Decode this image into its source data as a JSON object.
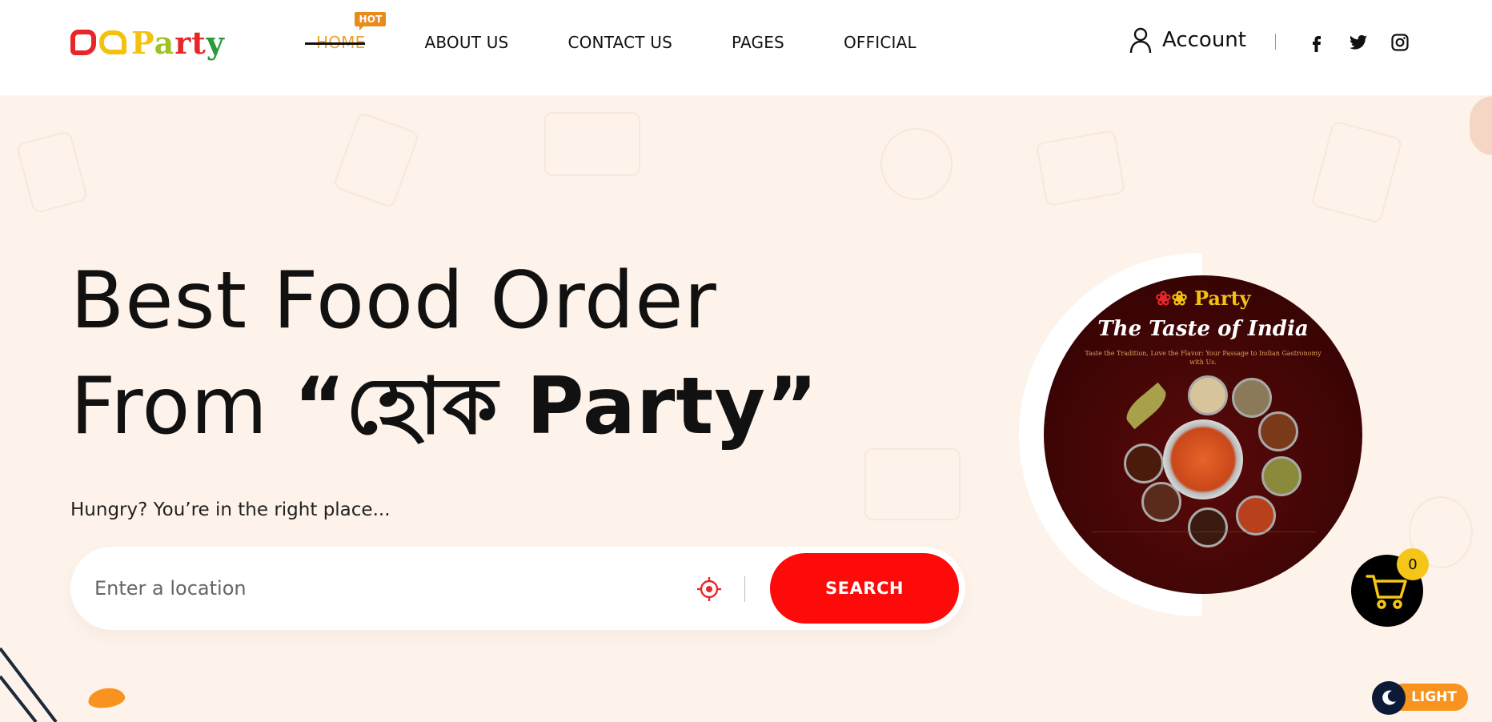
{
  "header": {
    "logo": {
      "alt": "হোক Party",
      "text_parts": [
        "P",
        "a",
        "r",
        "t",
        "y"
      ]
    },
    "nav": [
      {
        "label": "HOME",
        "active": true,
        "badge": "HOT"
      },
      {
        "label": "ABOUT US",
        "active": false
      },
      {
        "label": "CONTACT US",
        "active": false
      },
      {
        "label": "PAGES",
        "active": false
      },
      {
        "label": "OFFICIAL",
        "active": false
      }
    ],
    "account_label": "Account",
    "socials": [
      "facebook-icon",
      "twitter-icon",
      "instagram-icon"
    ]
  },
  "hero": {
    "title_line1": "Best Food Order",
    "title_line2_prefix": "From ",
    "title_line2_brand": "“হোক Party”",
    "subtitle": "Hungry? You’re in the right place..."
  },
  "search": {
    "placeholder": "Enter a location",
    "button_label": "SEARCH"
  },
  "promo": {
    "logo_text": "Party",
    "title": "The Taste of India",
    "tagline": "Taste the Tradition, Love the Flavor: Your Passage to Indian Gastronomy with Us."
  },
  "cart": {
    "count": "0"
  },
  "theme_toggle": {
    "label": "LIGHT"
  },
  "colors": {
    "accent_red": "#ff0a0a",
    "accent_orange": "#f7931e",
    "background": "#fdf3ea",
    "active_nav": "#f0a126",
    "cart_badge": "#f5c518"
  }
}
